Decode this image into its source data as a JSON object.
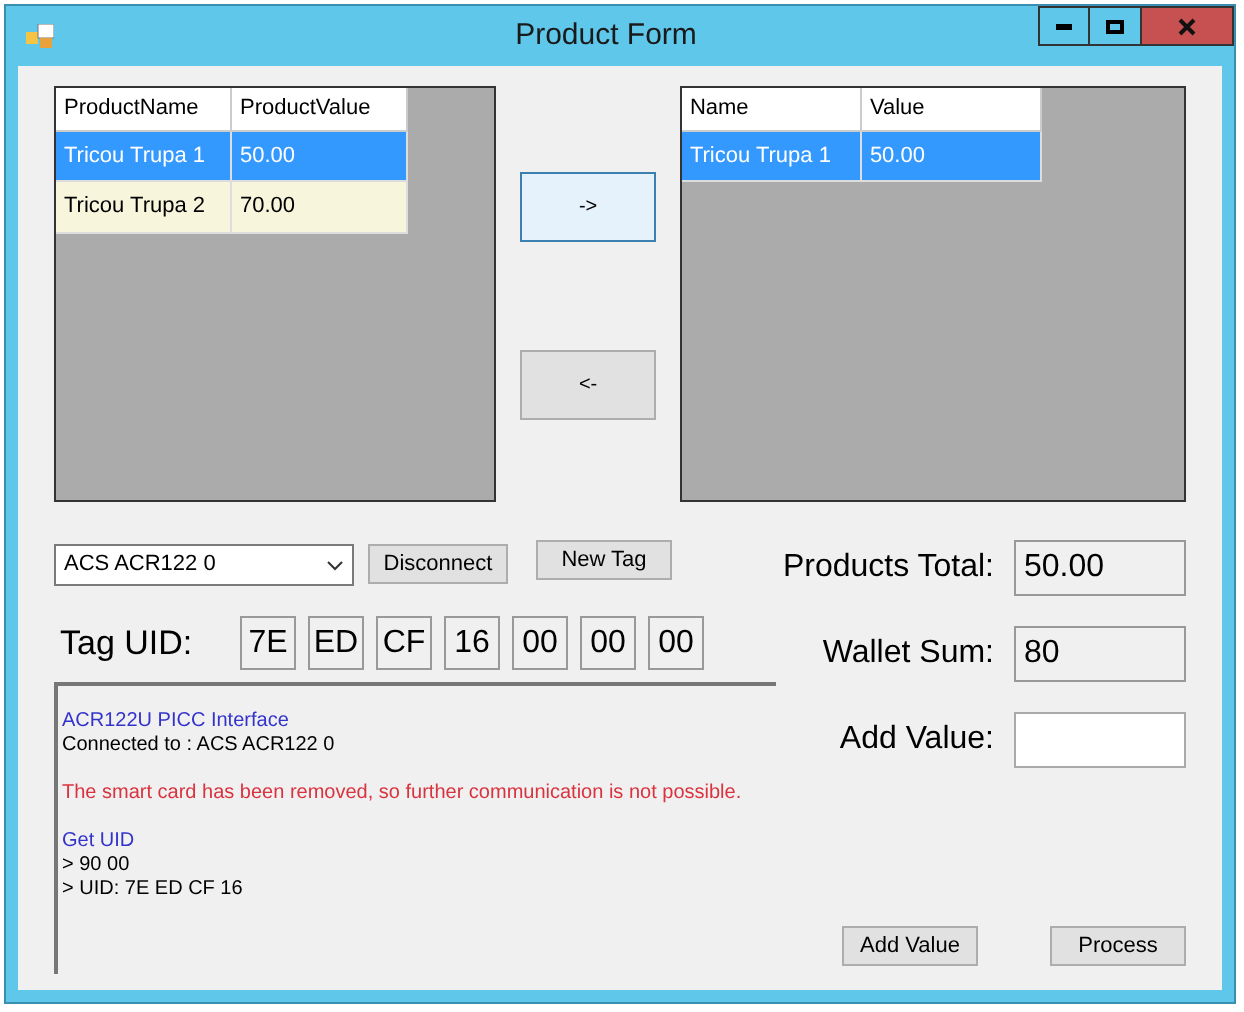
{
  "window": {
    "title": "Product Form"
  },
  "products_grid": {
    "columns": [
      "ProductName",
      "ProductValue"
    ],
    "rows": [
      {
        "cells": [
          "Tricou Trupa 1",
          "50.00"
        ],
        "selected": true
      },
      {
        "cells": [
          "Tricou Trupa 2",
          "70.00"
        ],
        "selected": false
      }
    ]
  },
  "move_buttons": [
    "->",
    "<-"
  ],
  "cart_grid": {
    "columns": [
      "Name",
      "Value"
    ],
    "rows": [
      {
        "cells": [
          "Tricou Trupa 1",
          "50.00"
        ],
        "selected": true
      }
    ]
  },
  "reader_select": {
    "value": "ACS ACR122 0"
  },
  "disconnect_button": "Disconnect",
  "new_tag_button": "New Tag",
  "tag_uid": {
    "label": "Tag UID:",
    "bytes": [
      "7E",
      "ED",
      "CF",
      "16",
      "00",
      "00",
      "00"
    ]
  },
  "log": [
    {
      "text": "ACR122U PICC Interface",
      "kind": "info"
    },
    {
      "text": "Connected to :  ACS ACR122 0",
      "kind": "plain"
    },
    {
      "text": "The smart card has been removed, so further communication is not possible.",
      "kind": "error",
      "gap_before": true
    },
    {
      "text": "Get UID",
      "kind": "info",
      "gap_before": true
    },
    {
      "text": "> 90 00",
      "kind": "plain"
    },
    {
      "text": "> UID: 7E ED CF 16",
      "kind": "plain"
    }
  ],
  "summary": [
    {
      "label": "Products Total:",
      "value": "50.00",
      "editable": false
    },
    {
      "label": "Wallet Sum:",
      "value": "80",
      "editable": false
    },
    {
      "label": "Add Value:",
      "editable": true
    }
  ],
  "action_buttons": [
    "Add Value",
    "Process"
  ]
}
